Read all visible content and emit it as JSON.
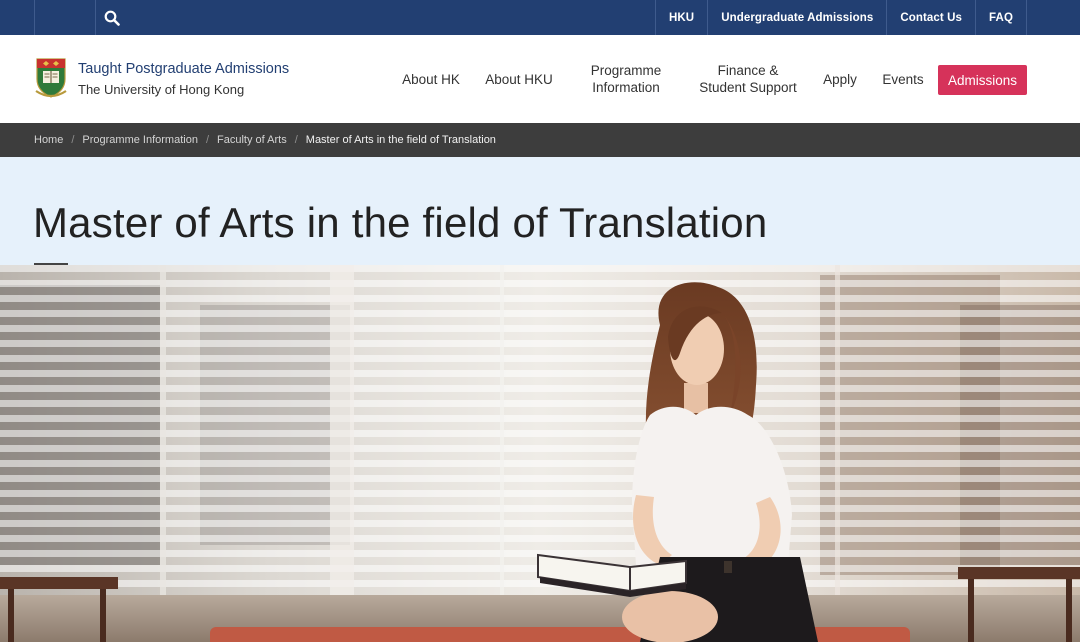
{
  "topbar": {
    "links": [
      {
        "label": "HKU"
      },
      {
        "label": "Undergraduate Admissions"
      },
      {
        "label": "Contact Us"
      },
      {
        "label": "FAQ"
      }
    ]
  },
  "header": {
    "brand_title": "Taught Postgraduate Admissions",
    "brand_subtitle": "The University of Hong Kong",
    "nav": [
      {
        "label": "About HK"
      },
      {
        "label": "About HKU"
      },
      {
        "label_line1": "Programme",
        "label_line2": "Information"
      },
      {
        "label_line1": "Finance &",
        "label_line2": "Student Support"
      },
      {
        "label": "Apply"
      },
      {
        "label": "Events"
      }
    ],
    "cta_label": "Admissions"
  },
  "breadcrumb": {
    "items": [
      "Home",
      "Programme Information",
      "Faculty of Arts"
    ],
    "current": "Master of Arts in the field of Translation",
    "separator": "/"
  },
  "page": {
    "title": "Master of Arts in the field of Translation"
  },
  "colors": {
    "topbar": "#223f72",
    "accent": "#d6325a",
    "breadcrumb_bg": "#3d3d3d",
    "title_band": "#e6f1fb"
  },
  "icons": {
    "search": "search-icon",
    "crest": "hku-crest-icon"
  }
}
